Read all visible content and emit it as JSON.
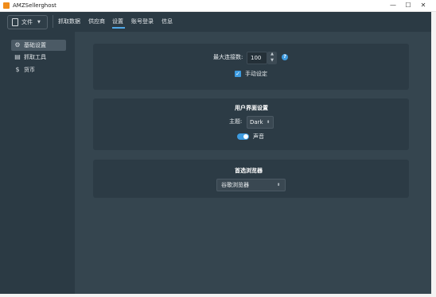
{
  "window": {
    "title": "AMZSellerghost",
    "minimize_glyph": "—",
    "maximize_glyph": "☐",
    "close_glyph": "✕"
  },
  "toolbar": {
    "file_label": "文件",
    "file_caret": "▼",
    "menu": [
      {
        "label": "抓取数据"
      },
      {
        "label": "供应商"
      },
      {
        "label": "设置"
      },
      {
        "label": "账号登录"
      },
      {
        "label": "信息"
      }
    ],
    "active_menu": "设置"
  },
  "sidebar": {
    "items": [
      {
        "label": "基础设置",
        "icon": "gear-icon",
        "glyph": "⚙"
      },
      {
        "label": "抓取工具",
        "icon": "table-icon",
        "glyph": "▤"
      },
      {
        "label": "货币",
        "icon": "dollar-icon",
        "glyph": "$"
      }
    ],
    "active_item": "基础设置"
  },
  "connection": {
    "label": "最大连接数:",
    "value": "100",
    "up_glyph": "▲",
    "down_glyph": "▼",
    "help_glyph": "?",
    "manual_label": "手动设定",
    "manual_checked": true,
    "check_glyph": "✓"
  },
  "ui_settings": {
    "title": "用户界面设置",
    "theme_label": "主题:",
    "theme_value": "Dark",
    "theme_caret": "⬍",
    "sound_label": "声音",
    "sound_on": true
  },
  "browser": {
    "title": "首选浏览器",
    "value": "谷歌浏览器",
    "caret": "⬍"
  },
  "colors": {
    "accent": "#3d9be0",
    "toolbar_bg": "#2b3a44",
    "main_bg": "#35454f",
    "card_bg": "#2c3b45",
    "brand": "#f08c1a"
  }
}
